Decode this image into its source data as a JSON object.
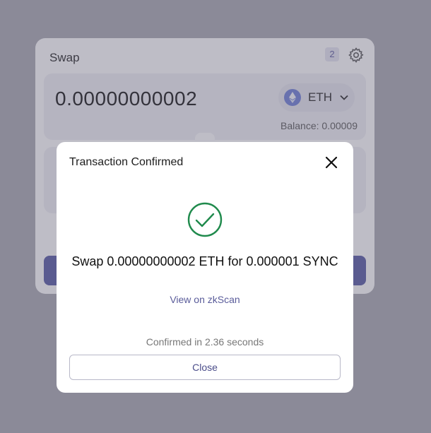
{
  "swap": {
    "title": "Swap",
    "pending_count": "2",
    "amount": "0.00000000002",
    "token": "ETH",
    "balance": "Balance: 0.00009"
  },
  "modal": {
    "title": "Transaction Confirmed",
    "summary": "Swap 0.00000000002 ETH for 0.000001 SYNC",
    "link": "View on zkScan",
    "confirmed_text": "Confirmed in 2.36 seconds",
    "close_label": "Close"
  },
  "colors": {
    "success": "#1f8a4c",
    "accent": "#5456a2",
    "eth": "#6c7dd6"
  },
  "icons": {
    "settings": "gear-icon",
    "close": "close-icon",
    "success": "check-circle-icon",
    "token": "ethereum-icon",
    "dropdown": "chevron-down-icon"
  }
}
